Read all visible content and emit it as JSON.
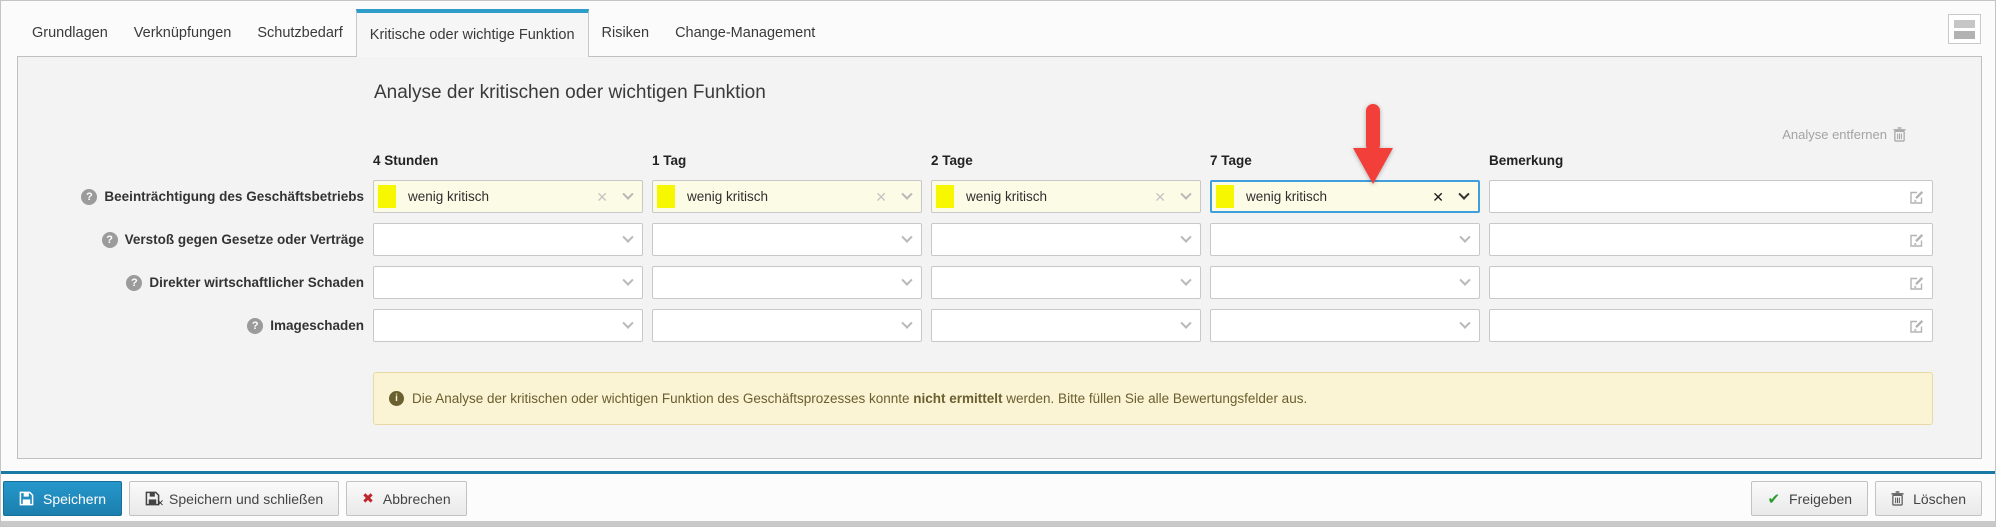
{
  "tabs": [
    {
      "label": "Grundlagen",
      "active": false
    },
    {
      "label": "Verknüpfungen",
      "active": false
    },
    {
      "label": "Schutzbedarf",
      "active": false
    },
    {
      "label": "Kritische oder wichtige Funktion",
      "active": true
    },
    {
      "label": "Risiken",
      "active": false
    },
    {
      "label": "Change-Management",
      "active": false
    }
  ],
  "panel": {
    "title": "Analyse der kritischen oder wichtigen Funktion",
    "remove_analysis_label": "Analyse entfernen",
    "columns": [
      "4 Stunden",
      "1 Tag",
      "2 Tage",
      "7 Tage",
      "Bemerkung"
    ],
    "rows": [
      {
        "label": "Beeinträchtigung des Geschäftsbetriebs",
        "values": [
          "wenig kritisch",
          "wenig kritisch",
          "wenig kritisch",
          "wenig kritisch"
        ],
        "bemerkung": ""
      },
      {
        "label": "Verstoß gegen Gesetze oder Verträge",
        "values": [
          "",
          "",
          "",
          ""
        ],
        "bemerkung": ""
      },
      {
        "label": "Direkter wirtschaftlicher Schaden",
        "values": [
          "",
          "",
          "",
          ""
        ],
        "bemerkung": ""
      },
      {
        "label": "Imageschaden",
        "values": [
          "",
          "",
          "",
          ""
        ],
        "bemerkung": ""
      }
    ],
    "warning": {
      "prefix": "Die Analyse der kritischen oder wichtigen Funktion des Geschäftsprozesses konnte ",
      "bold": "nicht ermittelt",
      "suffix": " werden. Bitte füllen Sie alle Bewertungsfelder aus."
    }
  },
  "footer": {
    "save": "Speichern",
    "save_and_close": "Speichern und schließen",
    "cancel": "Abbrechen",
    "release": "Freigeben",
    "delete": "Löschen"
  },
  "colors": {
    "accent_blue": "#2e9dc9",
    "primary_button_blue": "#1d87ba",
    "footer_rule_blue": "#1879a3",
    "swatch_yellow": "#f7f700",
    "select_filled_bg": "#fbfbe6",
    "focus_border_blue": "#3f9fdc",
    "warning_bg": "#faf3d4",
    "warning_text": "#6a5f2e",
    "arrow_red": "#f23f39"
  }
}
